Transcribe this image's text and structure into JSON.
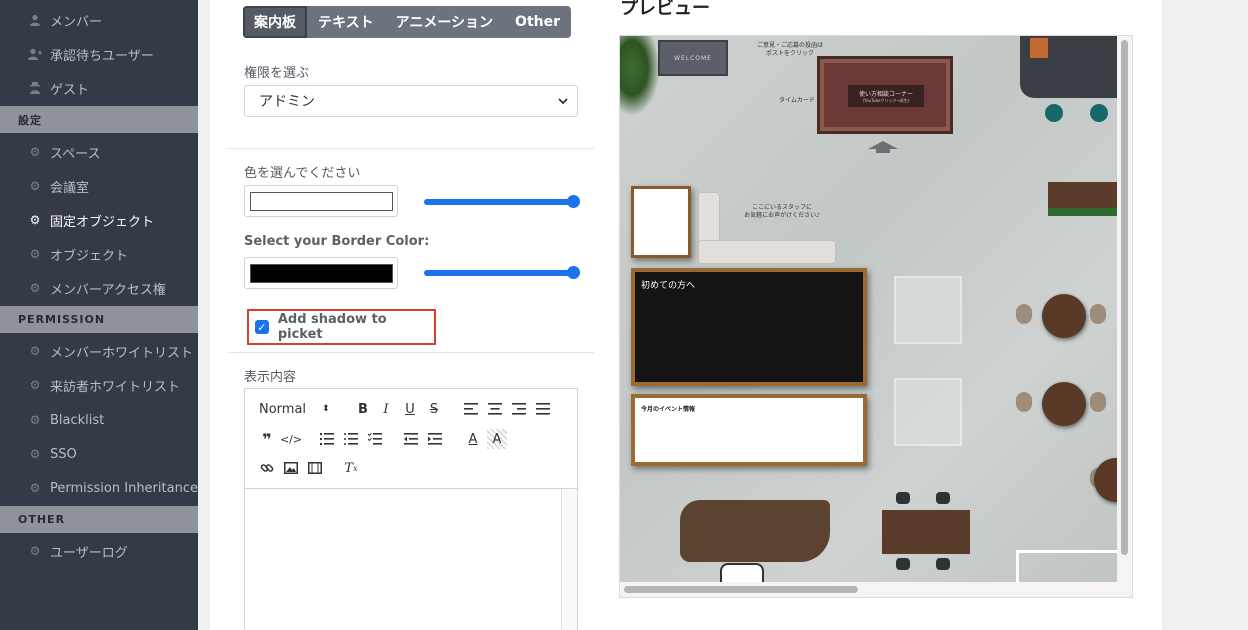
{
  "sidebar": {
    "items_top": [
      {
        "label": "メンバー",
        "icon": "user-icon"
      },
      {
        "label": "承認待ちユーザー",
        "icon": "user-plus-icon"
      },
      {
        "label": "ゲスト",
        "icon": "guest-icon"
      }
    ],
    "section_settings": "設定",
    "items_settings": [
      {
        "label": "スペース",
        "icon": "gear-icon"
      },
      {
        "label": "会議室",
        "icon": "gear-icon"
      },
      {
        "label": "固定オブジェクト",
        "icon": "gear-icon",
        "active": true
      },
      {
        "label": "オブジェクト",
        "icon": "gear-icon"
      },
      {
        "label": "メンバーアクセス権",
        "icon": "gear-icon"
      }
    ],
    "section_permission": "PERMISSION",
    "items_permission": [
      {
        "label": "メンバーホワイトリスト",
        "icon": "gear-icon"
      },
      {
        "label": "来訪者ホワイトリスト",
        "icon": "gear-icon"
      },
      {
        "label": "Blacklist",
        "icon": "gear-icon"
      },
      {
        "label": "SSO",
        "icon": "gear-icon"
      },
      {
        "label": "Permission Inheritance",
        "icon": "gear-icon"
      }
    ],
    "section_other": "OTHER",
    "items_other": [
      {
        "label": "ユーザーログ",
        "icon": "gear-icon"
      }
    ]
  },
  "tabs": [
    "案内板",
    "テキスト",
    "アニメーション",
    "Other"
  ],
  "form": {
    "permission_label": "権限を選ぶ",
    "permission_value": "アドミン",
    "color_label": "色を選んでください",
    "fill_color": "#ffffff",
    "border_label": "Select your Border Color:",
    "border_color": "#000000",
    "fill_opacity_slider": 1.0,
    "border_opacity_slider": 1.0,
    "shadow_label": "Add shadow to picket",
    "shadow_checked": true,
    "content_label": "表示内容",
    "format_select": "Normal"
  },
  "preview": {
    "title": "プレビュー",
    "welcome_mat": "WELCOME",
    "note_top": "ご意見・ご応募の投函は\nポストをクリック",
    "time_card": "タイムカード",
    "rug_title": "使い方相談コーナー",
    "rug_sub": "(YouTubeクリック→再生)",
    "staff_note": "ここにいるスタッフに\nお気軽にお声がけください♪",
    "board_first": "初めての方へ",
    "board_event": "今月のイベント情報"
  },
  "colors": {
    "accent": "#1a73e8",
    "highlight": "#d9402f",
    "sidebar_bg": "#343a46"
  }
}
